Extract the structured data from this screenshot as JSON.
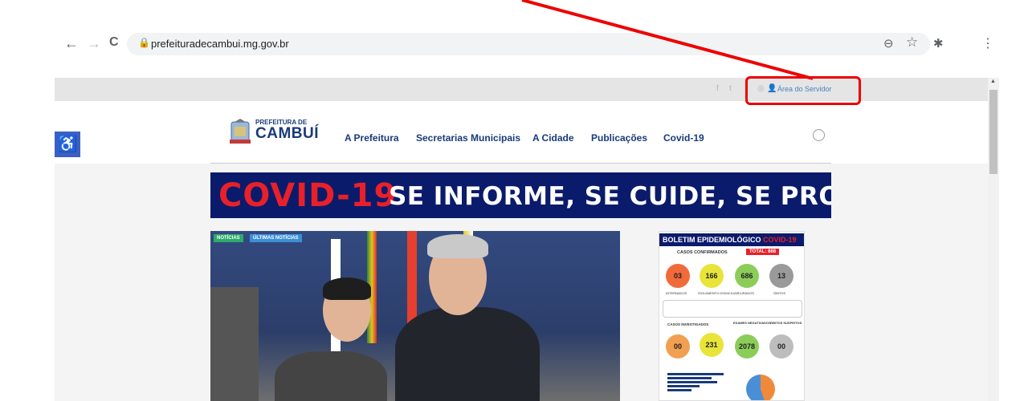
{
  "browser": {
    "back_icon": "←",
    "forward_icon": "→",
    "reload_icon": "C",
    "url": "prefeituradecambui.mg.gov.br",
    "zoom_icon": "⊖",
    "star_icon": "☆",
    "ext_icon": "✱",
    "menu_icon": "⋮"
  },
  "topbar": {
    "facebook": "f",
    "twitter": "t",
    "servidor_label": "Área do Servidor"
  },
  "header": {
    "logo_small": "PREFEITURA DE",
    "logo_big": "CAMBUÍ",
    "nav": [
      "A Prefeitura",
      "Secretarias Municipais",
      "A Cidade",
      "Publicações",
      "Covid-19"
    ]
  },
  "banner": {
    "red_text": "COVID-19",
    "white_text": "SE INFORME, SE CUIDE, SE PROTEJA"
  },
  "article": {
    "tag1": "NOTÍCIAS",
    "tag2": "ÚLTIMAS NOTÍCIAS"
  },
  "boletim": {
    "title_a": "BOLETIM EPIDEMIOLÓGICO",
    "title_b": "COVID-19",
    "confirmados": "CASOS CONFIRMADOS",
    "total": "TOTAL: 868",
    "b1": "03",
    "b2": "166",
    "b3": "686",
    "b4": "13",
    "l1": "INTERNADOS",
    "l2": "ISOLAMENTO DOMICILIAR",
    "l3": "CURADOS",
    "l4": "ÓBITOS",
    "investigados": "CASOS INVESTIGADOS",
    "negativos": "EXAMES NEGATIVADOS",
    "obitos_susp": "ÓBITOS SUSPEITOS",
    "c1": "00",
    "c2": "231",
    "c3": "2078",
    "c4": "00"
  },
  "accessibility": {
    "icon": "♿"
  },
  "colors": {
    "brand": "#1a3a7a",
    "banner_bg": "#0b1b6b",
    "accent_red": "#e8202a",
    "highlight": "#ee0000"
  }
}
